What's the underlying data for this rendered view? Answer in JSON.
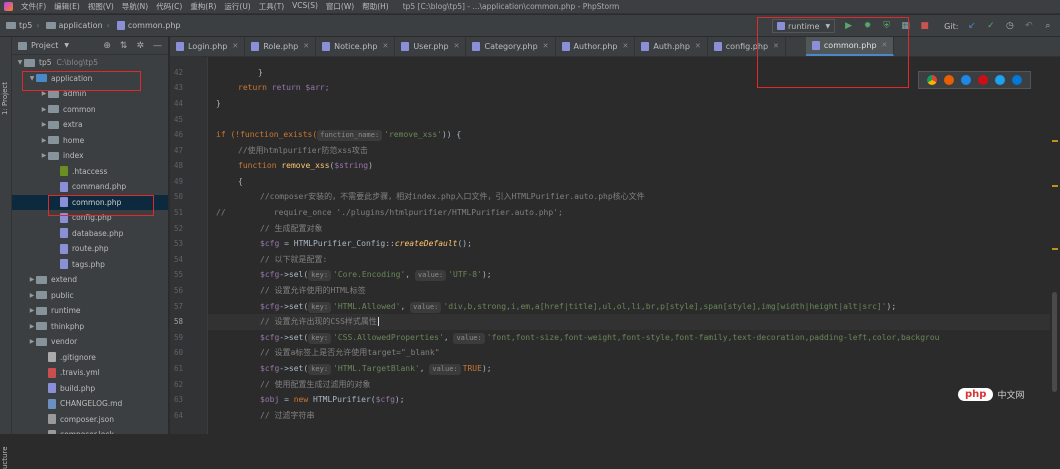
{
  "menubar": {
    "items": [
      "文件(F)",
      "编辑(E)",
      "视图(V)",
      "导航(N)",
      "代码(C)",
      "重构(R)",
      "运行(U)",
      "工具(T)",
      "VCS(S)",
      "窗口(W)",
      "帮助(H)"
    ],
    "title": "tp5 [C:\\blog\\tp5] - ...\\application\\common.php - PhpStorm"
  },
  "navbar": {
    "crumbs": [
      "tp5",
      "application",
      "common.php"
    ],
    "run_config": "runtime",
    "git_label": "Git:"
  },
  "sidebar_strip": {
    "top_label": "1: Project",
    "bottom_label": "ucture"
  },
  "project_panel": {
    "title": "Project",
    "tree": [
      {
        "label": "tp5",
        "extra": "C:\\blog\\tp5",
        "depth": 0,
        "kind": "folder",
        "arrow": "▼"
      },
      {
        "label": "application",
        "depth": 1,
        "kind": "folder",
        "arrow": "▼"
      },
      {
        "label": "admin",
        "depth": 2,
        "kind": "folder",
        "arrow": "▶"
      },
      {
        "label": "common",
        "depth": 2,
        "kind": "folder",
        "arrow": "▶"
      },
      {
        "label": "extra",
        "depth": 2,
        "kind": "folder",
        "arrow": "▶"
      },
      {
        "label": "home",
        "depth": 2,
        "kind": "folder",
        "arrow": "▶"
      },
      {
        "label": "index",
        "depth": 2,
        "kind": "folder",
        "arrow": "▶"
      },
      {
        "label": ".htaccess",
        "depth": 3,
        "kind": "htac"
      },
      {
        "label": "command.php",
        "depth": 3,
        "kind": "php"
      },
      {
        "label": "common.php",
        "depth": 3,
        "kind": "php",
        "selected": true
      },
      {
        "label": "config.php",
        "depth": 3,
        "kind": "php"
      },
      {
        "label": "database.php",
        "depth": 3,
        "kind": "php"
      },
      {
        "label": "route.php",
        "depth": 3,
        "kind": "php"
      },
      {
        "label": "tags.php",
        "depth": 3,
        "kind": "php"
      },
      {
        "label": "extend",
        "depth": 1,
        "kind": "folder",
        "arrow": "▶"
      },
      {
        "label": "public",
        "depth": 1,
        "kind": "folder",
        "arrow": "▶"
      },
      {
        "label": "runtime",
        "depth": 1,
        "kind": "folder",
        "arrow": "▶"
      },
      {
        "label": "thinkphp",
        "depth": 1,
        "kind": "folder",
        "arrow": "▶"
      },
      {
        "label": "vendor",
        "depth": 1,
        "kind": "folder",
        "arrow": "▶"
      },
      {
        "label": ".gitignore",
        "depth": 2,
        "kind": "git"
      },
      {
        "label": ".travis.yml",
        "depth": 2,
        "kind": "yml"
      },
      {
        "label": "build.php",
        "depth": 2,
        "kind": "php"
      },
      {
        "label": "CHANGELOG.md",
        "depth": 2,
        "kind": "md"
      },
      {
        "label": "composer.json",
        "depth": 2,
        "kind": "json"
      },
      {
        "label": "composer.lock",
        "depth": 2,
        "kind": "json"
      }
    ]
  },
  "tabs": [
    "Login.php",
    "Role.php",
    "Notice.php",
    "User.php",
    "Category.php",
    "Author.php",
    "Auth.php",
    "config.php",
    "common.php"
  ],
  "active_tab": "common.php",
  "line_numbers": [
    "42",
    "43",
    "44",
    "45",
    "46",
    "47",
    "48",
    "49",
    "50",
    "51",
    "52",
    "53",
    "54",
    "55",
    "56",
    "57",
    "58",
    "59",
    "60",
    "61",
    "62",
    "63",
    "64"
  ],
  "current_line": "58",
  "code": {
    "l42": "}",
    "l43": "return $arr;",
    "l44": "}",
    "l46_a": "if (!function_exists(",
    "l46_hint": "function_name:",
    "l46_str": "'remove_xss'",
    "l46_b": ")) {",
    "l47": "//使用htmlpurifier防范xss攻击",
    "l48_kw": "function",
    "l48_fn": "remove_xss",
    "l48_var": "$string",
    "l49": "{",
    "l50": "//composer安装的，不需要此步骤，相对index.php入口文件，引入HTMLPurifier.auto.php核心文件",
    "l51_c": "//",
    "l51_b": "require_once './plugins/htmlpurifier/HTMLPurifier.auto.php';",
    "l52": "// 生成配置对象",
    "l53_var": "$cfg",
    "l53_a": " = HTMLPurifier_Config::",
    "l53_fn": "createDefault",
    "l53_b": "();",
    "l54": "// 以下就是配置:",
    "l55_str1": "'Core.Encoding'",
    "l55_str2": "'UTF-8'",
    "l56": "// 设置允许使用的HTML标签",
    "l57_str1": "'HTML.Allowed'",
    "l57_str2": "'div,b,strong,i,em,a[href|title],ul,ol,li,br,p[style],span[style],img[width|height|alt|src]'",
    "l58": "// 设置允许出现的CSS样式属性",
    "l59_str1": "'CSS.AllowedProperties'",
    "l59_str2": "'font,font-size,font-weight,font-style,font-family,text-decoration,padding-left,color,backgrou",
    "l60": "// 设置a标签上是否允许使用target=\"_blank\"",
    "l61_str1": "'HTML.TargetBlank'",
    "l61_val": "TRUE",
    "l62": "// 使用配置生成过滤用的对象",
    "l63_var": "$obj",
    "l63_kw": "new",
    "l63_cls": "HTMLPurifier(",
    "l63_arg": "$cfg",
    "l63_end": ");",
    "l64": "// 过滤字符串",
    "hint_key": "key:",
    "hint_value": "value:",
    "set": "->set(",
    "sel": "->sel(",
    "cfg": "$cfg"
  },
  "watermark": {
    "logo": "php",
    "text": "中文网"
  }
}
